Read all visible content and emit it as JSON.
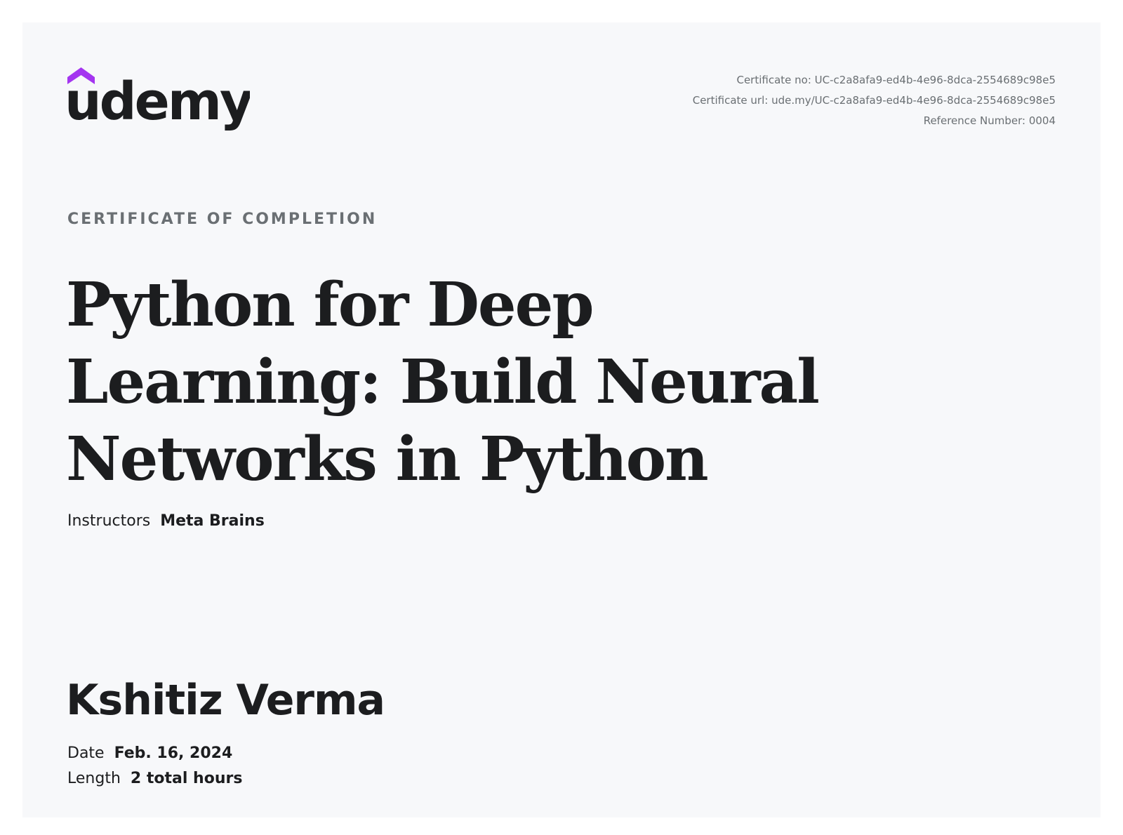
{
  "brand": {
    "logo_text": "udemy",
    "accent_color": "#a435f0",
    "text_color": "#1c1d1f"
  },
  "meta": {
    "certificate_no": "Certificate no: UC-c2a8afa9-ed4b-4e96-8dca-2554689c98e5",
    "certificate_url": "Certificate url: ude.my/UC-c2a8afa9-ed4b-4e96-8dca-2554689c98e5",
    "reference_number": "Reference Number: 0004"
  },
  "certificate": {
    "kicker": "CERTIFICATE OF COMPLETION",
    "course_title": "Python for Deep Learning: Build Neural Networks in Python",
    "instructors_label": "Instructors",
    "instructors_value": "Meta Brains",
    "student_name": "Kshitiz Verma",
    "date_label": "Date",
    "date_value": "Feb. 16, 2024",
    "length_label": "Length",
    "length_value": "2 total hours"
  }
}
